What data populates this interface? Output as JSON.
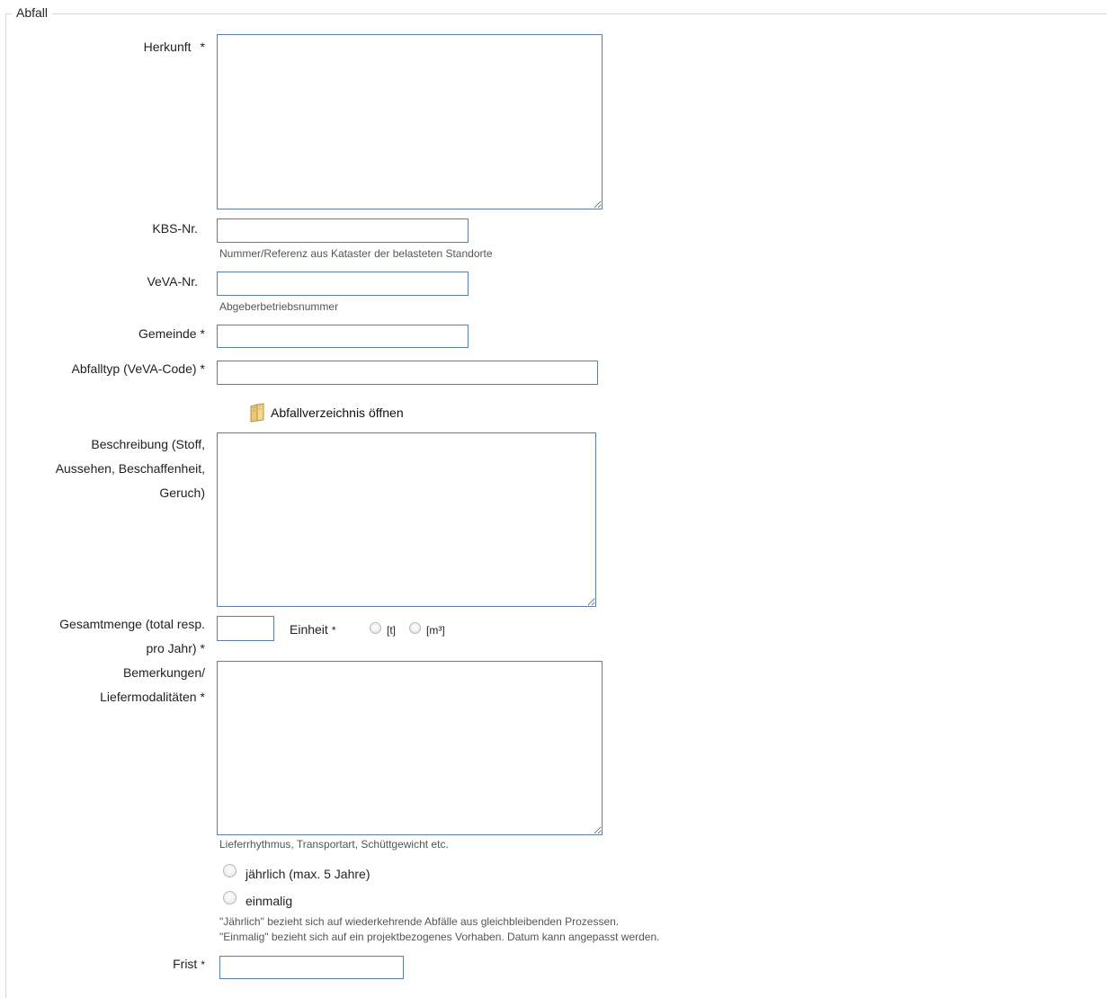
{
  "section": {
    "legend": "Abfall"
  },
  "fields": {
    "herkunft": {
      "label": "Herkunft",
      "required": "*",
      "value": ""
    },
    "kbs": {
      "label": "KBS-Nr.",
      "value": "",
      "hint": "Nummer/Referenz aus Kataster der belasteten Standorte"
    },
    "veva": {
      "label": "VeVA-Nr.",
      "value": "",
      "hint": "Abgeberbetriebsnummer"
    },
    "gemeinde": {
      "label": "Gemeinde",
      "required": "*",
      "value": ""
    },
    "abfalltyp": {
      "label": "Abfalltyp (VeVA-Code)",
      "required": "*",
      "value": ""
    },
    "verzeichnis_link": "Abfallverzeichnis öffnen",
    "beschreibung": {
      "label_line1": "Beschreibung (Stoff,",
      "label_line2": "Aussehen, Beschaffenheit,",
      "label_line3": "Geruch)",
      "value": ""
    },
    "gesamtmenge": {
      "label_line1": "Gesamtmenge (total resp.",
      "label_line2": "pro Jahr)",
      "required": "*",
      "value": ""
    },
    "einheit": {
      "label": "Einheit",
      "required": "*",
      "options": [
        "[t]",
        "[m³]"
      ]
    },
    "bemerkungen": {
      "label_line1": "Bemerkungen/",
      "label_line2": "Liefermodalitäten",
      "required": "*",
      "value": "",
      "hint": "Lieferrhythmus, Transportart, Schüttgewicht etc."
    },
    "turnus": {
      "options": [
        "jährlich (max. 5 Jahre)",
        "einmalig"
      ],
      "hint_line1": "\"Jährlich\" bezieht sich auf wiederkehrende Abfälle aus gleichbleibenden Prozessen.",
      "hint_line2": "\"Einmalig\" bezieht sich auf ein projektbezogenes Vorhaben. Datum kann angepasst werden."
    },
    "frist": {
      "label": "Frist",
      "required": "*",
      "value": ""
    }
  },
  "icons": {
    "verzeichnis_icon": "book-icon"
  }
}
